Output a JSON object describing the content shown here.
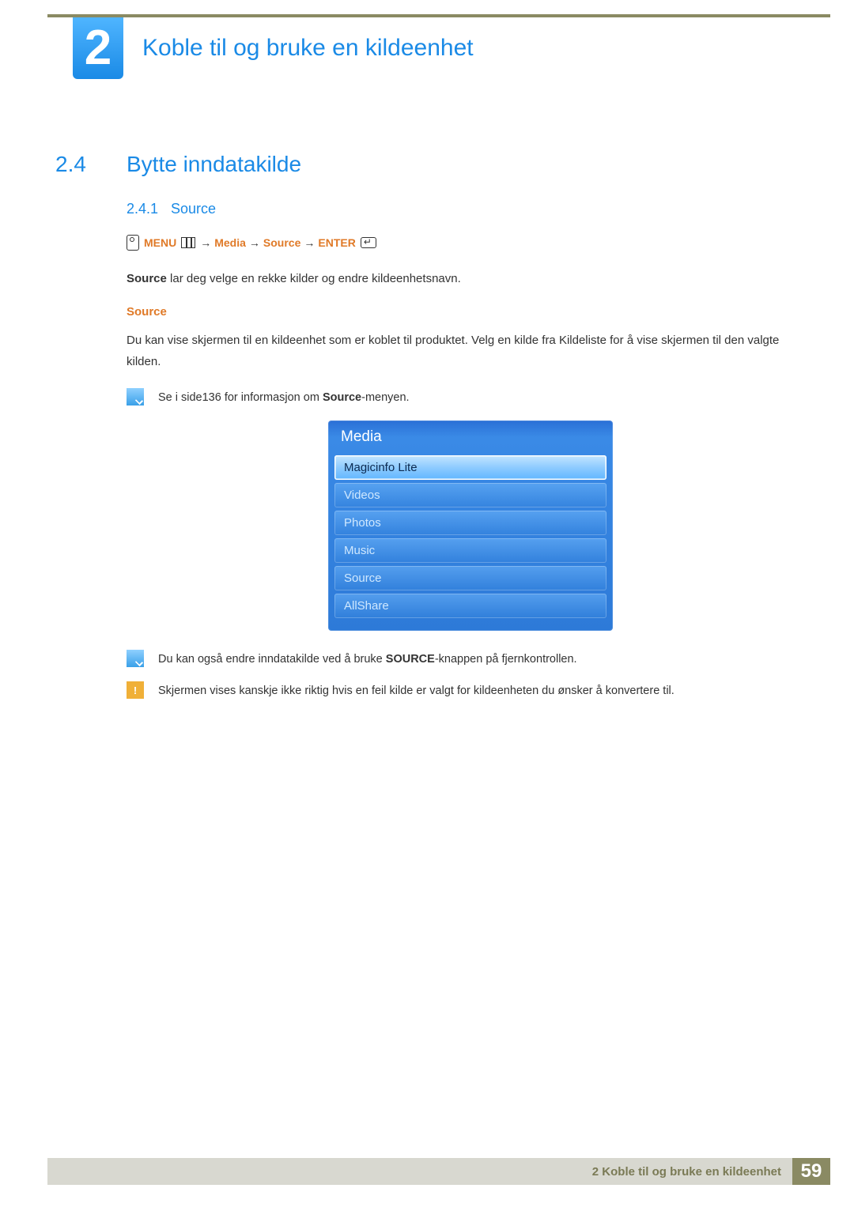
{
  "chapter": {
    "number": "2",
    "title": "Koble til og bruke en kildeenhet"
  },
  "section": {
    "number": "2.4",
    "title": "Bytte inndatakilde"
  },
  "subsection": {
    "number": "2.4.1",
    "title": "Source"
  },
  "nav_path": {
    "menu": "MENU",
    "arrow1": "→",
    "media": "Media",
    "arrow2": "→",
    "source": "Source",
    "arrow3": "→",
    "enter": "ENTER"
  },
  "intro": {
    "bold": "Source",
    "rest": " lar deg velge en rekke kilder og endre kildeenhetsnavn."
  },
  "source_heading": "Source",
  "source_body": "Du kan vise skjermen til en kildeenhet som er koblet til produktet. Velg en kilde fra Kildeliste for å vise skjermen til den valgte kilden.",
  "note1": {
    "pre": "Se i side136 for informasjon om ",
    "bold": "Source",
    "post": "-menyen."
  },
  "menu": {
    "title": "Media",
    "items": [
      {
        "label": "Magicinfo Lite",
        "selected": true
      },
      {
        "label": "Videos",
        "selected": false
      },
      {
        "label": "Photos",
        "selected": false
      },
      {
        "label": "Music",
        "selected": false
      },
      {
        "label": "Source",
        "selected": false
      },
      {
        "label": "AllShare",
        "selected": false
      }
    ]
  },
  "note2": {
    "pre": "Du kan også endre inndatakilde ved å bruke ",
    "bold": "SOURCE",
    "post": "-knappen på fjernkontrollen."
  },
  "warn": {
    "text": "Skjermen vises kanskje ikke riktig hvis en feil kilde er valgt for kildeenheten du ønsker å konvertere til."
  },
  "footer": {
    "label": "2 Koble til og bruke en kildeenhet",
    "page": "59"
  }
}
